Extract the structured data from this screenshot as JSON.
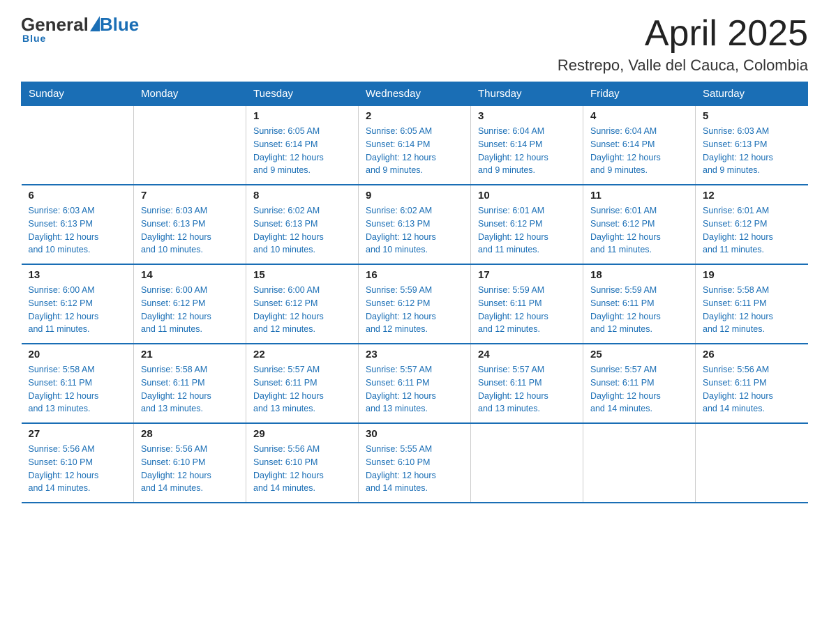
{
  "header": {
    "logo_general": "General",
    "logo_blue": "Blue",
    "title": "April 2025",
    "subtitle": "Restrepo, Valle del Cauca, Colombia"
  },
  "weekdays": [
    "Sunday",
    "Monday",
    "Tuesday",
    "Wednesday",
    "Thursday",
    "Friday",
    "Saturday"
  ],
  "weeks": [
    [
      {
        "day": "",
        "info": ""
      },
      {
        "day": "",
        "info": ""
      },
      {
        "day": "1",
        "info": "Sunrise: 6:05 AM\nSunset: 6:14 PM\nDaylight: 12 hours\nand 9 minutes."
      },
      {
        "day": "2",
        "info": "Sunrise: 6:05 AM\nSunset: 6:14 PM\nDaylight: 12 hours\nand 9 minutes."
      },
      {
        "day": "3",
        "info": "Sunrise: 6:04 AM\nSunset: 6:14 PM\nDaylight: 12 hours\nand 9 minutes."
      },
      {
        "day": "4",
        "info": "Sunrise: 6:04 AM\nSunset: 6:14 PM\nDaylight: 12 hours\nand 9 minutes."
      },
      {
        "day": "5",
        "info": "Sunrise: 6:03 AM\nSunset: 6:13 PM\nDaylight: 12 hours\nand 9 minutes."
      }
    ],
    [
      {
        "day": "6",
        "info": "Sunrise: 6:03 AM\nSunset: 6:13 PM\nDaylight: 12 hours\nand 10 minutes."
      },
      {
        "day": "7",
        "info": "Sunrise: 6:03 AM\nSunset: 6:13 PM\nDaylight: 12 hours\nand 10 minutes."
      },
      {
        "day": "8",
        "info": "Sunrise: 6:02 AM\nSunset: 6:13 PM\nDaylight: 12 hours\nand 10 minutes."
      },
      {
        "day": "9",
        "info": "Sunrise: 6:02 AM\nSunset: 6:13 PM\nDaylight: 12 hours\nand 10 minutes."
      },
      {
        "day": "10",
        "info": "Sunrise: 6:01 AM\nSunset: 6:12 PM\nDaylight: 12 hours\nand 11 minutes."
      },
      {
        "day": "11",
        "info": "Sunrise: 6:01 AM\nSunset: 6:12 PM\nDaylight: 12 hours\nand 11 minutes."
      },
      {
        "day": "12",
        "info": "Sunrise: 6:01 AM\nSunset: 6:12 PM\nDaylight: 12 hours\nand 11 minutes."
      }
    ],
    [
      {
        "day": "13",
        "info": "Sunrise: 6:00 AM\nSunset: 6:12 PM\nDaylight: 12 hours\nand 11 minutes."
      },
      {
        "day": "14",
        "info": "Sunrise: 6:00 AM\nSunset: 6:12 PM\nDaylight: 12 hours\nand 11 minutes."
      },
      {
        "day": "15",
        "info": "Sunrise: 6:00 AM\nSunset: 6:12 PM\nDaylight: 12 hours\nand 12 minutes."
      },
      {
        "day": "16",
        "info": "Sunrise: 5:59 AM\nSunset: 6:12 PM\nDaylight: 12 hours\nand 12 minutes."
      },
      {
        "day": "17",
        "info": "Sunrise: 5:59 AM\nSunset: 6:11 PM\nDaylight: 12 hours\nand 12 minutes."
      },
      {
        "day": "18",
        "info": "Sunrise: 5:59 AM\nSunset: 6:11 PM\nDaylight: 12 hours\nand 12 minutes."
      },
      {
        "day": "19",
        "info": "Sunrise: 5:58 AM\nSunset: 6:11 PM\nDaylight: 12 hours\nand 12 minutes."
      }
    ],
    [
      {
        "day": "20",
        "info": "Sunrise: 5:58 AM\nSunset: 6:11 PM\nDaylight: 12 hours\nand 13 minutes."
      },
      {
        "day": "21",
        "info": "Sunrise: 5:58 AM\nSunset: 6:11 PM\nDaylight: 12 hours\nand 13 minutes."
      },
      {
        "day": "22",
        "info": "Sunrise: 5:57 AM\nSunset: 6:11 PM\nDaylight: 12 hours\nand 13 minutes."
      },
      {
        "day": "23",
        "info": "Sunrise: 5:57 AM\nSunset: 6:11 PM\nDaylight: 12 hours\nand 13 minutes."
      },
      {
        "day": "24",
        "info": "Sunrise: 5:57 AM\nSunset: 6:11 PM\nDaylight: 12 hours\nand 13 minutes."
      },
      {
        "day": "25",
        "info": "Sunrise: 5:57 AM\nSunset: 6:11 PM\nDaylight: 12 hours\nand 14 minutes."
      },
      {
        "day": "26",
        "info": "Sunrise: 5:56 AM\nSunset: 6:11 PM\nDaylight: 12 hours\nand 14 minutes."
      }
    ],
    [
      {
        "day": "27",
        "info": "Sunrise: 5:56 AM\nSunset: 6:10 PM\nDaylight: 12 hours\nand 14 minutes."
      },
      {
        "day": "28",
        "info": "Sunrise: 5:56 AM\nSunset: 6:10 PM\nDaylight: 12 hours\nand 14 minutes."
      },
      {
        "day": "29",
        "info": "Sunrise: 5:56 AM\nSunset: 6:10 PM\nDaylight: 12 hours\nand 14 minutes."
      },
      {
        "day": "30",
        "info": "Sunrise: 5:55 AM\nSunset: 6:10 PM\nDaylight: 12 hours\nand 14 minutes."
      },
      {
        "day": "",
        "info": ""
      },
      {
        "day": "",
        "info": ""
      },
      {
        "day": "",
        "info": ""
      }
    ]
  ]
}
